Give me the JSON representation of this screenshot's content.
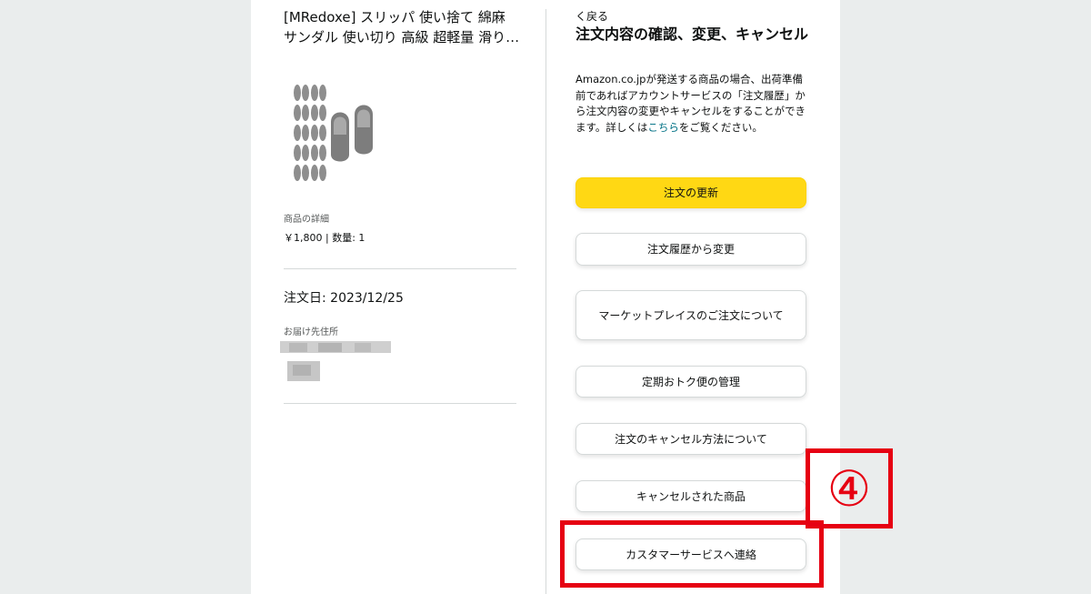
{
  "product": {
    "title_line1": "[MRedoxe] スリッパ 使い捨て 綿麻",
    "title_line2": "サンダル 使い切り 高級 超軽量 滑り…",
    "details_label": "商品の詳細",
    "price_qty": "￥1,800 | 数量: 1",
    "image_icon": "slipper-product-image"
  },
  "order": {
    "date_text": "注文日: 2023/12/25",
    "address_label": "お届け先住所"
  },
  "panel": {
    "back_label": "く戻る",
    "title": "注文内容の確認、変更、キャンセル",
    "help_before": "Amazon.co.jpが発送する商品の場合、出荷準備前であればアカウントサービスの「注文履歴」から注文内容の変更やキャンセルをすることができます。詳しくは",
    "help_link": "こちら",
    "help_after": "をご覧ください。"
  },
  "buttons": {
    "update_order": "注文の更新",
    "change_from_history": "注文履歴から変更",
    "marketplace_orders": "マーケットプレイスのご注文について",
    "subscribe_save": "定期おトク便の管理",
    "cancel_howto": "注文のキャンセル方法について",
    "cancelled_items": "キャンセルされた商品",
    "contact_cs": "カスタマーサービスへ連絡"
  },
  "annotation": {
    "step_marker": "④",
    "highlight_color": "#e60012"
  },
  "colors": {
    "primary_button": "#ffd814",
    "link": "#007185"
  }
}
